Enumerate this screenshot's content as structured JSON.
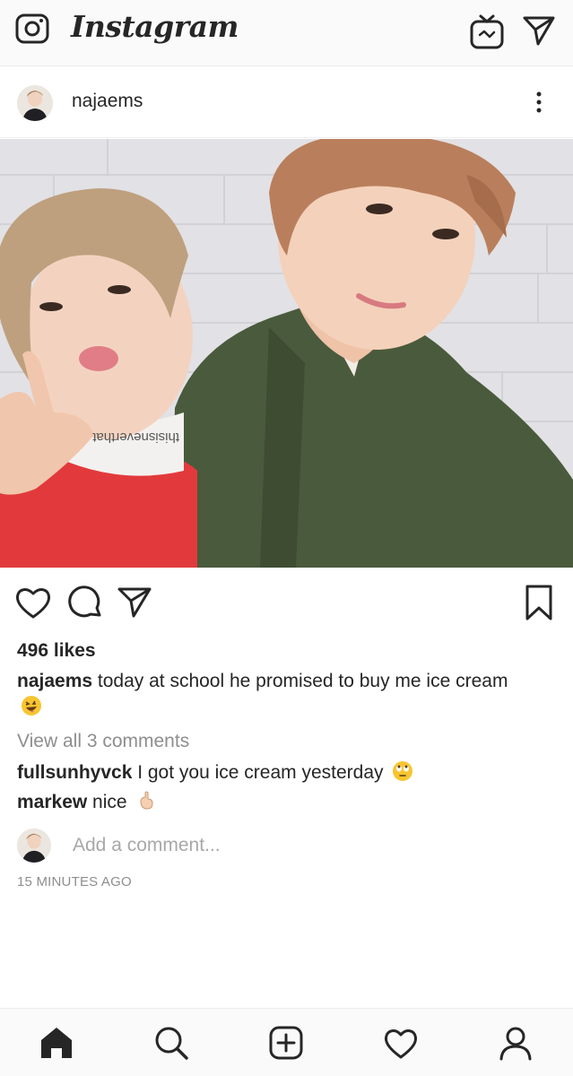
{
  "app": {
    "logo": "Instagram"
  },
  "topbar": {
    "icons": [
      "camera-icon",
      "igtv-icon",
      "direct-message-icon"
    ]
  },
  "post": {
    "username": "najaems",
    "likes": "496 likes",
    "caption_user": "najaems",
    "caption_text": " today at school he promised to buy me ice cream",
    "caption_emoji": "grinning-squinting-emoji",
    "view_all": "View all 3 comments",
    "comments": [
      {
        "user": "fullsunhyvck",
        "text": " I got you ice cream yesterday",
        "emoji": "eye-roll-emoji"
      },
      {
        "user": "markew",
        "text": " nice",
        "emoji": "backhand-index-emoji"
      }
    ],
    "add_comment_placeholder": "Add a comment...",
    "timestamp": "15 MINUTES AGO"
  },
  "photo_text": {
    "collar": "thisisneverthat"
  },
  "bottom_nav": [
    "home-icon",
    "search-icon",
    "add-post-icon",
    "activity-heart-icon",
    "profile-icon"
  ],
  "colors": {
    "text": "#262626",
    "muted": "#8e8e8e",
    "bar_bg": "#fafafa"
  }
}
